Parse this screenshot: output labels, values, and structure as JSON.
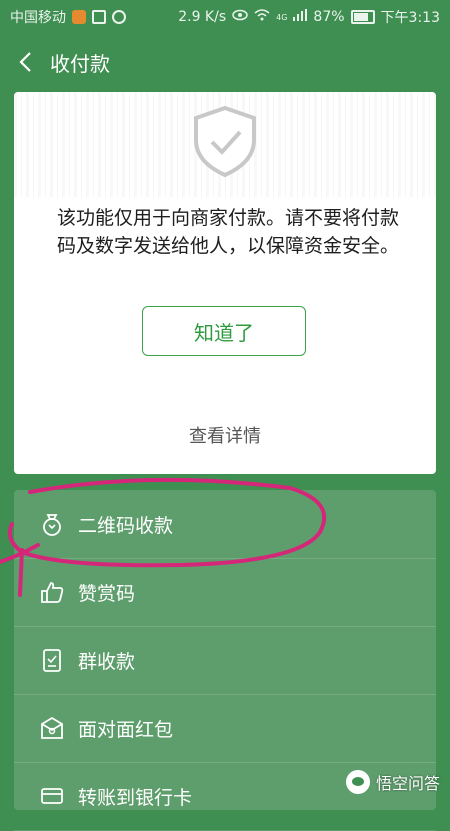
{
  "status_bar": {
    "carrier": "中国移动",
    "speed": "2.9 K/s",
    "network": "4G",
    "battery": "87%",
    "time": "下午3:13"
  },
  "header": {
    "title": "收付款"
  },
  "card": {
    "notice": "该功能仅用于向商家付款。请不要将付款码及数字发送给他人，以保障资金安全。",
    "ok_button": "知道了",
    "details_link": "查看详情"
  },
  "menu": {
    "items": [
      {
        "label": "二维码收款",
        "icon": "money-bag-icon"
      },
      {
        "label": "赞赏码",
        "icon": "thumbs-up-icon"
      },
      {
        "label": "群收款",
        "icon": "checklist-icon"
      },
      {
        "label": "面对面红包",
        "icon": "red-envelope-icon"
      },
      {
        "label": "转账到银行卡",
        "icon": "bank-card-icon"
      }
    ]
  },
  "watermark": {
    "text": "悟空问答"
  },
  "colors": {
    "background": "#3f8f52",
    "menu_bg": "#5e9e6d",
    "accent_green": "#2f9a3e",
    "annotation": "#d4277a"
  }
}
